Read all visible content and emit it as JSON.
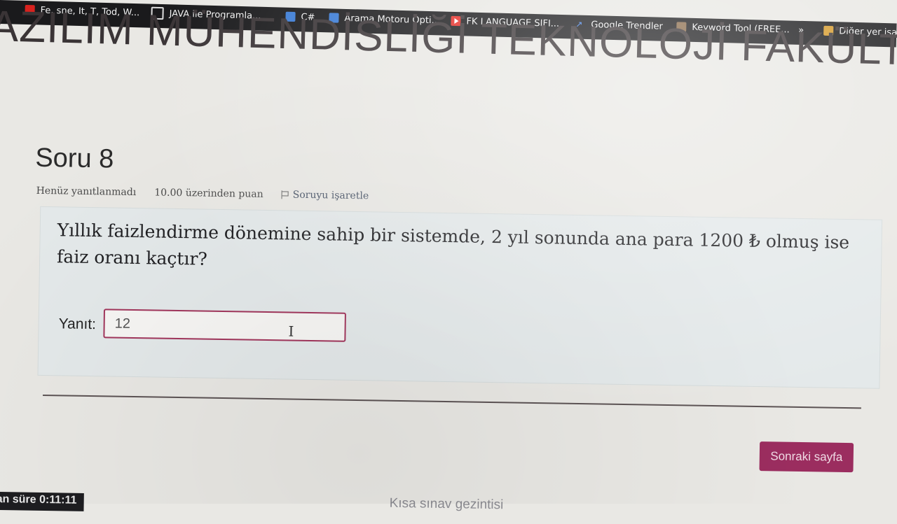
{
  "bookmarks": [
    {
      "label": "Fe, sne, It, T, Tod, W...",
      "icon": "red-icon"
    },
    {
      "label": "JAVA ile Programla...",
      "icon": "globe-icon"
    },
    {
      "label": "C#",
      "icon": "bookmark-icon"
    },
    {
      "label": "Arama Motoru Opti...",
      "icon": "bookmark-icon"
    },
    {
      "label": "FK LANGUAGE SIFI...",
      "icon": "youtube-icon"
    },
    {
      "label": "Google Trendler",
      "icon": "trends-icon"
    },
    {
      "label": "Keyword Tool (FREE...",
      "icon": "bookmark-icon"
    },
    {
      "label": "»",
      "icon": ""
    },
    {
      "label": "Diğer yer işare",
      "icon": "folder-icon"
    }
  ],
  "faculty_header": "AZILIM MÜHENDİSLİĞİ TEKNOLOJİ FAKÜLTESİ",
  "question": {
    "title": "Soru 8",
    "status": "Henüz yanıtlanmadı",
    "points": "10.00 üzerinden puan",
    "flag_label": "Soruyu işaretle",
    "text_line1": "Yıllık faizlendirme dönemine sahip bir sistemde, 2 yıl sonunda ana para 1200 ₺ olmuş ise",
    "text_line2": "faiz oranı kaçtır?",
    "answer_label": "Yanıt:",
    "answer_value": "12"
  },
  "next_button": "Sonraki sayfa",
  "timer": "an süre 0:11:11",
  "nav_link": "Kısa sınav gezintisi",
  "colors": {
    "accent": "#9b2d5f",
    "input_border": "#a2365c",
    "bookmark_bar": "#1a1a1c"
  }
}
